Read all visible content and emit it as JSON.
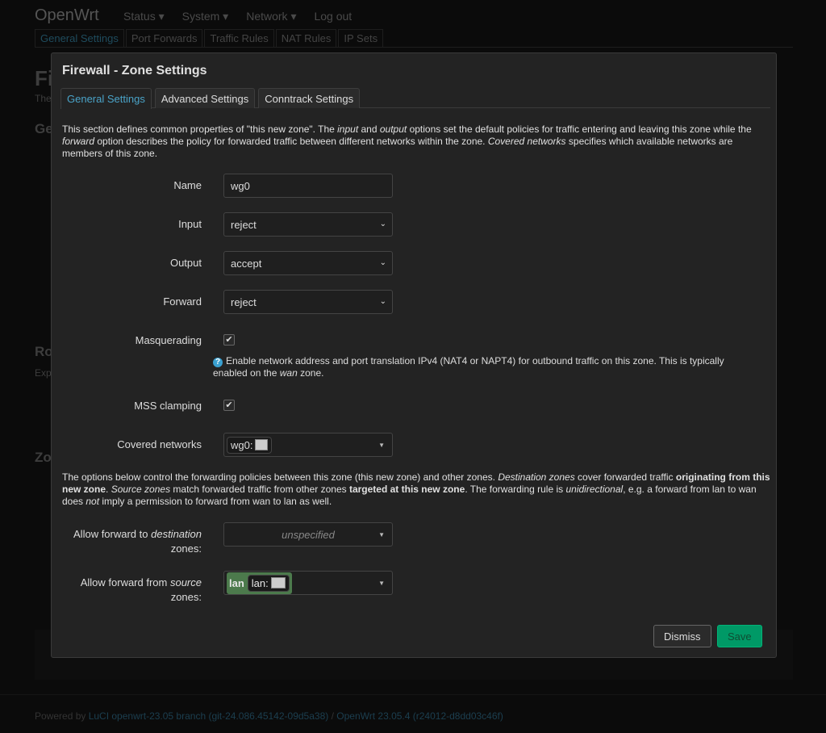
{
  "header": {
    "brand": "OpenWrt",
    "nav": [
      "Status ▾",
      "System ▾",
      "Network ▾",
      "Log out"
    ]
  },
  "subtabs": [
    "General Settings",
    "Port Forwards",
    "Traffic Rules",
    "NAT Rules",
    "IP Sets"
  ],
  "background": {
    "h1": "Fi",
    "p1": "The",
    "h2": "Ge",
    "h3": "Ro",
    "p3": "Exp",
    "h4": "Zo"
  },
  "footer": {
    "prefix": "Powered by ",
    "luci": "LuCI openwrt-23.05 branch (git-24.086.45142-09d5a38)",
    "sep": " / ",
    "openwrt": "OpenWrt 23.05.4 (r24012-d8dd03c46f)"
  },
  "modal": {
    "title": "Firewall - Zone Settings",
    "tabs": [
      "General Settings",
      "Advanced Settings",
      "Conntrack Settings"
    ],
    "active_tab": 0,
    "intro": [
      [
        "This section defines common properties of \"this new zone\". The ",
        ""
      ],
      [
        "input",
        "i"
      ],
      [
        " and ",
        ""
      ],
      [
        "output",
        "i"
      ],
      [
        " options set the default policies for traffic entering and leaving this zone while the ",
        ""
      ],
      [
        "forward",
        "i"
      ],
      [
        " option describes the policy for forwarded traffic between different networks within the zone. ",
        ""
      ],
      [
        "Covered networks",
        "i"
      ],
      [
        " specifies which available networks are members of this zone.",
        ""
      ]
    ],
    "fields": {
      "name": {
        "label": "Name",
        "value": "wg0"
      },
      "input": {
        "label": "Input",
        "value": "reject"
      },
      "output": {
        "label": "Output",
        "value": "accept"
      },
      "forward": {
        "label": "Forward",
        "value": "reject"
      },
      "masq": {
        "label": "Masquerading",
        "checked": true
      },
      "masq_help": [
        [
          "Enable network address and port translation IPv4 (NAT4 or NAPT4) for outbound traffic on this zone. This is typically enabled on the ",
          ""
        ],
        [
          "wan",
          "i"
        ],
        [
          " zone.",
          ""
        ]
      ],
      "mss": {
        "label": "MSS clamping",
        "checked": true
      },
      "covered": {
        "label": "Covered networks",
        "value": "wg0:",
        "icon": "network-interface-icon"
      }
    },
    "fwd_intro": [
      [
        "The options below control the forwarding policies between this zone (this new zone) and other zones. ",
        ""
      ],
      [
        "Destination zones",
        "i"
      ],
      [
        " cover forwarded traffic ",
        ""
      ],
      [
        "originating from this new zone",
        "b"
      ],
      [
        ". ",
        ""
      ],
      [
        "Source zones",
        "i"
      ],
      [
        " match forwarded traffic from other zones ",
        ""
      ],
      [
        "targeted at this new zone",
        "b"
      ],
      [
        ". The forwarding rule is ",
        ""
      ],
      [
        "unidirectional",
        "i"
      ],
      [
        ", e.g. a forward from lan to wan does ",
        ""
      ],
      [
        "not",
        "i"
      ],
      [
        " imply a permission to forward from wan to lan as well.",
        ""
      ]
    ],
    "dest": {
      "label_a": "Allow forward to ",
      "label_i": "destination",
      "label_b": " zones:",
      "placeholder": "unspecified"
    },
    "src": {
      "label_a": "Allow forward from ",
      "label_i": "source",
      "label_b": " zones:",
      "zone": "lan",
      "net": "lan:",
      "zone_color": "#4c7a4c"
    },
    "dismiss": "Dismiss",
    "save": "Save"
  },
  "colors": {
    "accent": "#4aa3c8",
    "save": "#009966"
  }
}
